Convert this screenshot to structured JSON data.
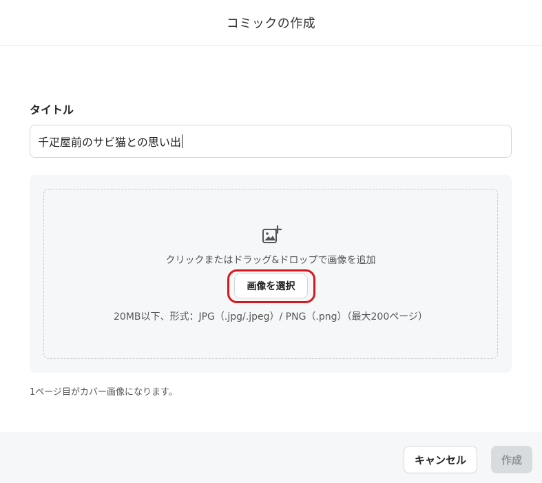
{
  "header": {
    "title": "コミックの作成"
  },
  "form": {
    "title_label": "タイトル",
    "title_value": "千疋屋前のサビ猫との思い出"
  },
  "upload": {
    "icon": "add-image-icon",
    "drop_hint": "クリックまたはドラッグ&ドロップで画像を追加",
    "select_label": "画像を選択",
    "format_hint": "20MB以下、形式：JPG（.jpg/.jpeg）/ PNG（.png）（最大200ページ）",
    "highlight_color": "#d9161c"
  },
  "cover_note": "1ページ目がカバー画像になります。",
  "footer": {
    "cancel_label": "キャンセル",
    "create_label": "作成",
    "create_disabled": true
  }
}
